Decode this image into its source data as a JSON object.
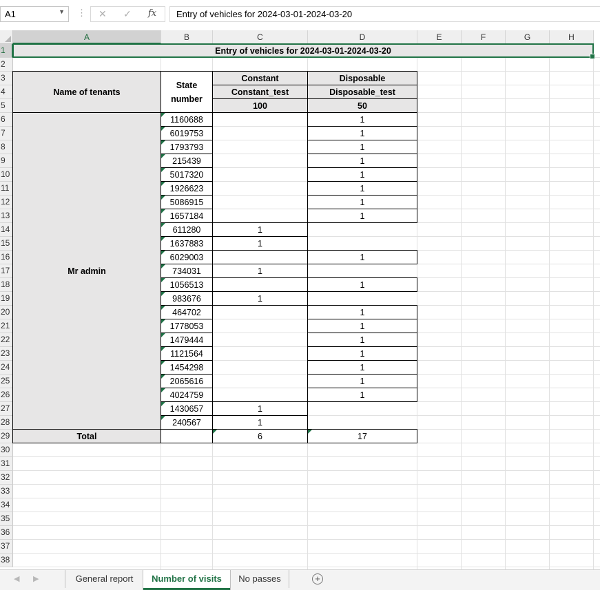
{
  "formula_bar": {
    "name_box": "A1",
    "cancel_icon": "✕",
    "enter_icon": "✓",
    "fx_label": "fx",
    "content": "Entry of vehicles for 2024-03-01-2024-03-20"
  },
  "columns": [
    "A",
    "B",
    "C",
    "D",
    "E",
    "F",
    "G",
    "H"
  ],
  "rows": [
    "1",
    "2",
    "3",
    "4",
    "5",
    "6",
    "7",
    "8",
    "9",
    "10",
    "11",
    "12",
    "13",
    "14",
    "15",
    "16",
    "17",
    "18",
    "19",
    "20",
    "21",
    "22",
    "23",
    "24",
    "25",
    "26",
    "27",
    "28",
    "29",
    "30",
    "31",
    "32",
    "33",
    "34",
    "35",
    "36",
    "37",
    "38"
  ],
  "sheet": {
    "title": "Entry of vehicles for 2024-03-01-2024-03-20",
    "header": {
      "tenants": "Name of tenants",
      "state_number": "State number",
      "constant": "Constant",
      "constant_test": "Constant_test",
      "constant_price": "100",
      "disposable": "Disposable",
      "disposable_test": "Disposable_test",
      "disposable_price": "50"
    },
    "tenant_name": "Mr admin",
    "records": [
      {
        "number": "1160688",
        "constant": "",
        "disposable": "1"
      },
      {
        "number": "6019753",
        "constant": "",
        "disposable": "1"
      },
      {
        "number": "1793793",
        "constant": "",
        "disposable": "1"
      },
      {
        "number": "215439",
        "constant": "",
        "disposable": "1"
      },
      {
        "number": "5017320",
        "constant": "",
        "disposable": "1"
      },
      {
        "number": "1926623",
        "constant": "",
        "disposable": "1"
      },
      {
        "number": "5086915",
        "constant": "",
        "disposable": "1"
      },
      {
        "number": "1657184",
        "constant": "",
        "disposable": "1"
      },
      {
        "number": "611280",
        "constant": "1",
        "disposable": ""
      },
      {
        "number": "1637883",
        "constant": "1",
        "disposable": ""
      },
      {
        "number": "6029003",
        "constant": "",
        "disposable": "1"
      },
      {
        "number": "734031",
        "constant": "1",
        "disposable": ""
      },
      {
        "number": "1056513",
        "constant": "",
        "disposable": "1"
      },
      {
        "number": "983676",
        "constant": "1",
        "disposable": ""
      },
      {
        "number": "464702",
        "constant": "",
        "disposable": "1"
      },
      {
        "number": "1778053",
        "constant": "",
        "disposable": "1"
      },
      {
        "number": "1479444",
        "constant": "",
        "disposable": "1"
      },
      {
        "number": "1121564",
        "constant": "",
        "disposable": "1"
      },
      {
        "number": "1454298",
        "constant": "",
        "disposable": "1"
      },
      {
        "number": "2065616",
        "constant": "",
        "disposable": "1"
      },
      {
        "number": "4024759",
        "constant": "",
        "disposable": "1"
      },
      {
        "number": "1430657",
        "constant": "1",
        "disposable": ""
      },
      {
        "number": "240567",
        "constant": "1",
        "disposable": ""
      }
    ],
    "total_label": "Total",
    "total_constant": "6",
    "total_disposable": "17"
  },
  "tabs": [
    {
      "label": "General report",
      "active": false
    },
    {
      "label": "Number of visits",
      "active": true
    },
    {
      "label": "No passes",
      "active": false
    }
  ],
  "add_sheet": "+",
  "colors": {
    "accent": "#217346",
    "header_fill": "#e7e6e6",
    "grid": "#e1e1e1"
  }
}
